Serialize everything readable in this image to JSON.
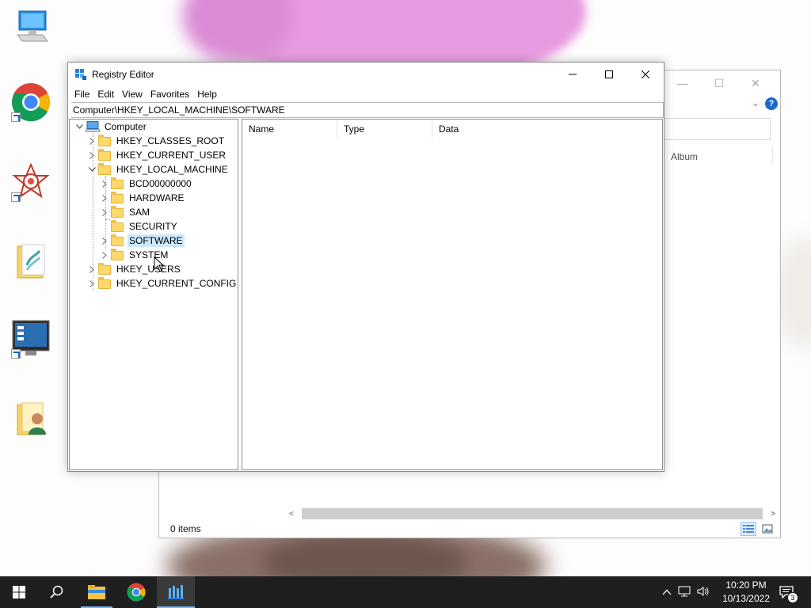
{
  "background_window": {
    "column_album": "Album",
    "status_text": "0 items",
    "help_label": "?"
  },
  "regedit": {
    "title": "Registry Editor",
    "menu": [
      "File",
      "Edit",
      "View",
      "Favorites",
      "Help"
    ],
    "address": "Computer\\HKEY_LOCAL_MACHINE\\SOFTWARE",
    "tree": {
      "root": "Computer",
      "hkey_classes_root": "HKEY_CLASSES_ROOT",
      "hkey_current_user": "HKEY_CURRENT_USER",
      "hkey_local_machine": "HKEY_LOCAL_MACHINE",
      "bcd": "BCD00000000",
      "hardware": "HARDWARE",
      "sam": "SAM",
      "security": "SECURITY",
      "software": "SOFTWARE",
      "system": "SYSTEM",
      "hkey_users": "HKEY_USERS",
      "hkey_current_config": "HKEY_CURRENT_CONFIG"
    },
    "columns": [
      "Name",
      "Type",
      "Data"
    ],
    "selected_key": "SOFTWARE"
  },
  "taskbar": {
    "time": "10:20 PM",
    "date": "10/13/2022",
    "notification_count": "3"
  },
  "colors": {
    "taskbar_bg": "#1f1f1f",
    "selection": "#cce8ff",
    "accent": "#76b9ed"
  }
}
